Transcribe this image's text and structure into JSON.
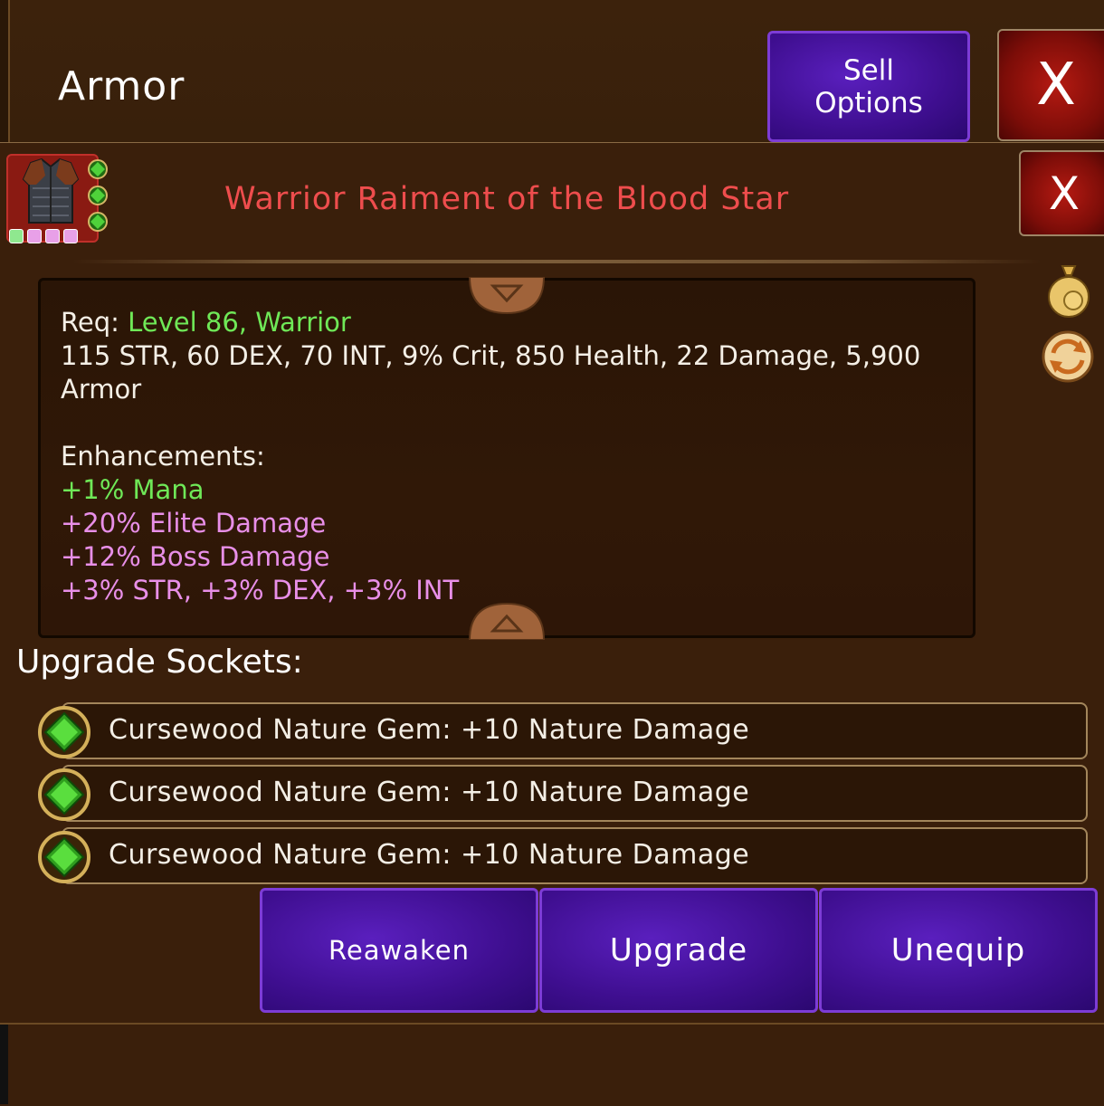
{
  "header": {
    "title": "Armor",
    "sell_label_line1": "Sell",
    "sell_label_line2": "Options",
    "close_label": "X"
  },
  "item": {
    "name": "Warrior Raiment of the Blood Star",
    "close_label": "X",
    "icon": "armor-vest-icon",
    "socket_dots_colors": [
      "#8fe88f",
      "#e8a0e8",
      "#e8a0e8",
      "#e8a0e8"
    ]
  },
  "description": {
    "req_prefix": "Req:",
    "req_level": "Level 86,",
    "req_class": "Warrior",
    "stats_line1": "115 STR, 60 DEX, 70 INT, 9% Crit, 850 Health, 22 Damage, 5,900",
    "stats_line2": "Armor",
    "enhancements_title": "Enhancements:",
    "enhancements": [
      "+1% Mana",
      "+20% Elite Damage",
      "+12% Boss Damage",
      "+3% STR, +3% DEX, +3% INT"
    ]
  },
  "side_icons": [
    "gold-bag-icon",
    "swap-icon"
  ],
  "sockets": {
    "title": "Upgrade Sockets:",
    "items": [
      "Cursewood Nature Gem: +10 Nature Damage",
      "Cursewood Nature Gem: +10 Nature Damage",
      "Cursewood Nature Gem: +10 Nature Damage"
    ]
  },
  "actions": {
    "reawaken": "Reawaken",
    "upgrade": "Upgrade",
    "unequip": "Unequip"
  },
  "colors": {
    "item_name": "#ee4d4d",
    "green_text": "#6fe857",
    "pink_text": "#e88fe8",
    "button_purple": "#3e0e8f",
    "close_red": "#b51a12"
  }
}
